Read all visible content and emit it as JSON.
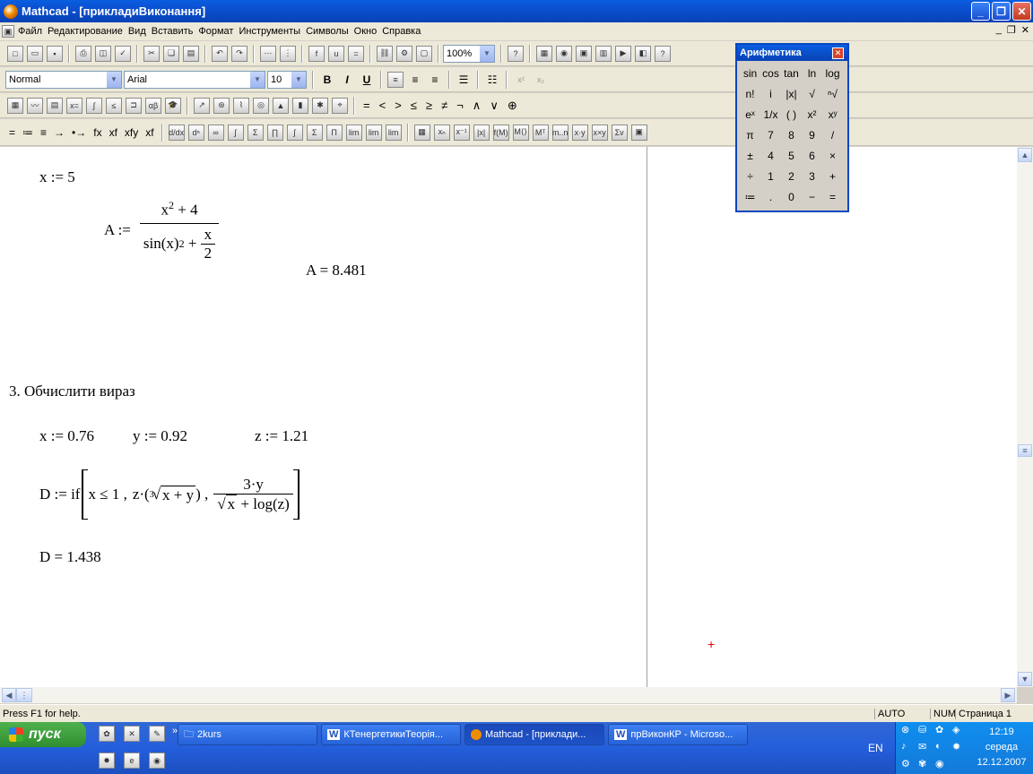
{
  "title": "Mathcad - [прикладиВиконання]",
  "menu": [
    "Файл",
    "Редактирование",
    "Вид",
    "Вставить",
    "Формат",
    "Инструменты",
    "Символы",
    "Окно",
    "Справка"
  ],
  "format_bar": {
    "style": "Normal",
    "font": "Arial",
    "size": "10"
  },
  "zoom": "100%",
  "toolbar4_symbols": [
    "=",
    "≔",
    "≡",
    "→",
    "•→",
    "fx",
    "xf",
    "xfy",
    "xf"
  ],
  "toolbar3_symbols": [
    "=",
    "<",
    ">",
    "≤",
    "≥",
    "≠",
    "¬",
    "∧",
    "∨",
    "⊕"
  ],
  "palette": {
    "title": "Арифметика",
    "cells": [
      "sin",
      "cos",
      "tan",
      "ln",
      "log",
      "n!",
      "i",
      "|x|",
      "√",
      "ⁿ√",
      "eˣ",
      "1/x",
      "( )",
      "x²",
      "xʸ",
      "π",
      "7",
      "8",
      "9",
      "/",
      "±",
      "4",
      "5",
      "6",
      "×",
      "÷",
      "1",
      "2",
      "3",
      "+",
      "≔",
      ".",
      "0",
      "−",
      "="
    ]
  },
  "doc": {
    "partial_top": "",
    "x_def": "x := 5",
    "A_lhs": "A :=",
    "A_num": "x",
    "A_num_exp": "2",
    "A_num_rest": " + 4",
    "A_den_a": "sin(x)",
    "A_den_exp": "2",
    "A_den_b": " + ",
    "A_den_frac_num": "x",
    "A_den_frac_den": "2",
    "A_result": "A = 8.481",
    "heading": "3. Обчислити вираз",
    "x_val": "x := 0.76",
    "y_val": "y := 0.92",
    "z_val": "z := 1.21",
    "D_lhs": "D := if",
    "D_cond": "x ≤ 1 ,",
    "D_t1": "z·(",
    "D_root_idx": "3",
    "D_root_body": "x + y",
    "D_t1_end": ") ,",
    "D_frac_num": "3·y",
    "D_frac_sqrt": "x",
    "D_frac_rest": " + log(z)",
    "D_result": "D = 1.438"
  },
  "status": {
    "help": "Press F1 for help.",
    "auto": "AUTO",
    "num": "NUM",
    "page": "Страница 1"
  },
  "taskbar": {
    "start": "пуск",
    "buttons": [
      "2kurs",
      "КТенергетикиТеорія...",
      "Mathcad - [приклади...",
      "прВиконКР - Microso..."
    ],
    "lang": "EN",
    "time": "12:19",
    "day": "середа",
    "date": "12.12.2007"
  }
}
